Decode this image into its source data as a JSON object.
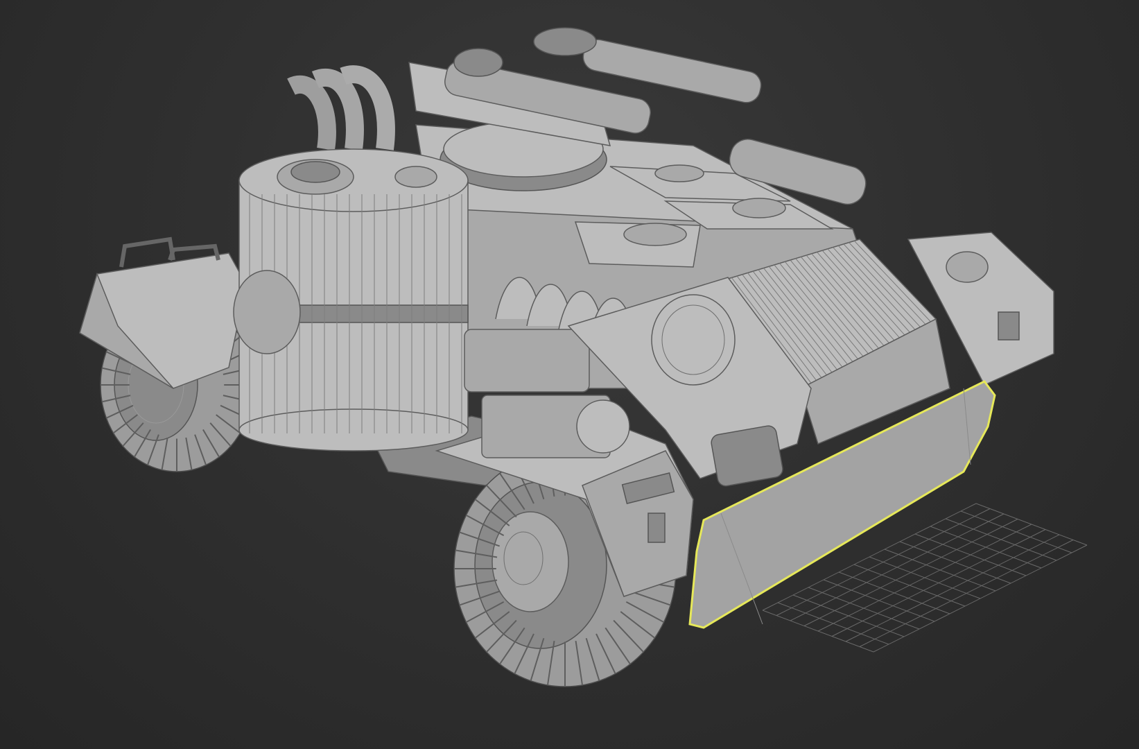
{
  "viewport": {
    "background_color": "#2b2b2b",
    "model_color": "#a9a9a9",
    "wireframe_color": "#5c5c5c",
    "selection_color": "#e6e85a",
    "grid_color": "#7a7a7a"
  },
  "scene_objects": [
    {
      "name": "vehicle-body"
    },
    {
      "name": "fuel-tank"
    },
    {
      "name": "turret-cannons"
    },
    {
      "name": "exhaust-pipes"
    },
    {
      "name": "front-left-wheel"
    },
    {
      "name": "rear-left-wheel"
    },
    {
      "name": "radiator-grille"
    },
    {
      "name": "front-bumper",
      "selected": true
    }
  ]
}
